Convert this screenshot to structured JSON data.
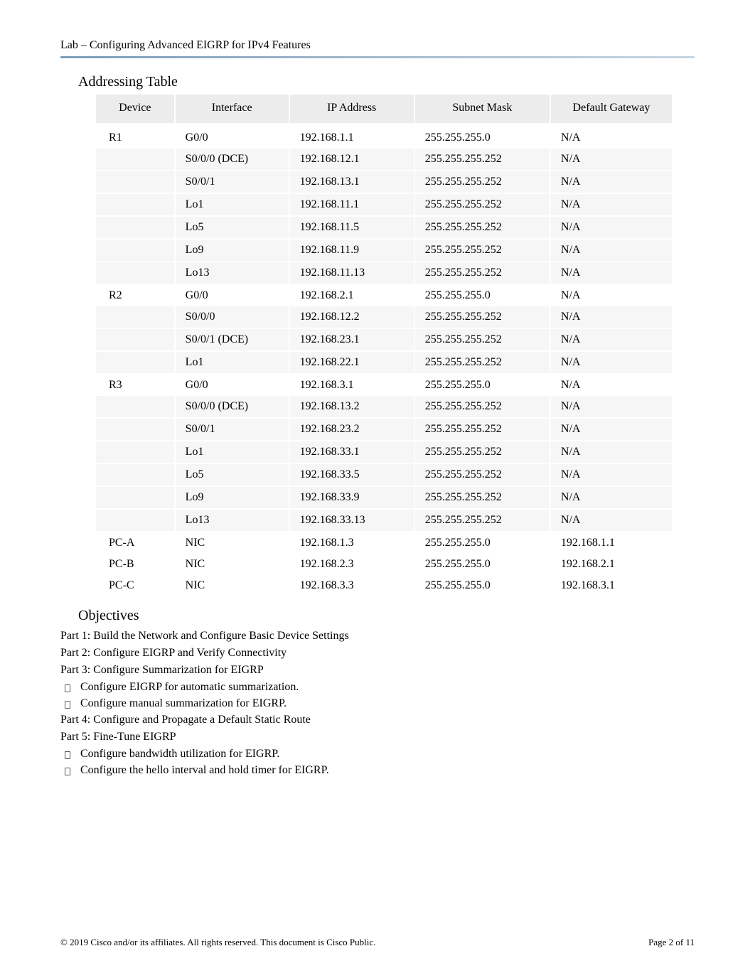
{
  "header": {
    "title": "Lab – Configuring Advanced EIGRP for IPv4 Features"
  },
  "sections": {
    "addressing_heading": "Addressing Table",
    "objectives_heading": "Objectives"
  },
  "table": {
    "headers": {
      "device": "Device",
      "interface": "Interface",
      "ip": "IP Address",
      "mask": "Subnet Mask",
      "gateway": "Default Gateway"
    },
    "rows": [
      {
        "device": "R1",
        "interface": "G0/0",
        "ip": "192.168.1.1",
        "mask": "255.255.255.0",
        "gateway": "N/A",
        "zebra": false
      },
      {
        "device": "",
        "interface": "S0/0/0 (DCE)",
        "ip": "192.168.12.1",
        "mask": "255.255.255.252",
        "gateway": "N/A",
        "zebra": true
      },
      {
        "device": "",
        "interface": "S0/0/1",
        "ip": "192.168.13.1",
        "mask": "255.255.255.252",
        "gateway": "N/A",
        "zebra": true
      },
      {
        "device": "",
        "interface": "Lo1",
        "ip": "192.168.11.1",
        "mask": "255.255.255.252",
        "gateway": "N/A",
        "zebra": true
      },
      {
        "device": "",
        "interface": "Lo5",
        "ip": "192.168.11.5",
        "mask": "255.255.255.252",
        "gateway": "N/A",
        "zebra": true
      },
      {
        "device": "",
        "interface": "Lo9",
        "ip": "192.168.11.9",
        "mask": "255.255.255.252",
        "gateway": "N/A",
        "zebra": true
      },
      {
        "device": "",
        "interface": "Lo13",
        "ip": "192.168.11.13",
        "mask": "255.255.255.252",
        "gateway": "N/A",
        "zebra": true
      },
      {
        "device": "R2",
        "interface": "G0/0",
        "ip": "192.168.2.1",
        "mask": "255.255.255.0",
        "gateway": "N/A",
        "zebra": false
      },
      {
        "device": "",
        "interface": "S0/0/0",
        "ip": "192.168.12.2",
        "mask": "255.255.255.252",
        "gateway": "N/A",
        "zebra": true
      },
      {
        "device": "",
        "interface": "S0/0/1 (DCE)",
        "ip": "192.168.23.1",
        "mask": "255.255.255.252",
        "gateway": "N/A",
        "zebra": true
      },
      {
        "device": "",
        "interface": "Lo1",
        "ip": "192.168.22.1",
        "mask": "255.255.255.252",
        "gateway": "N/A",
        "zebra": true
      },
      {
        "device": "R3",
        "interface": "G0/0",
        "ip": "192.168.3.1",
        "mask": "255.255.255.0",
        "gateway": "N/A",
        "zebra": false
      },
      {
        "device": "",
        "interface": "S0/0/0 (DCE)",
        "ip": "192.168.13.2",
        "mask": "255.255.255.252",
        "gateway": "N/A",
        "zebra": true
      },
      {
        "device": "",
        "interface": "S0/0/1",
        "ip": "192.168.23.2",
        "mask": "255.255.255.252",
        "gateway": "N/A",
        "zebra": true
      },
      {
        "device": "",
        "interface": "Lo1",
        "ip": "192.168.33.1",
        "mask": "255.255.255.252",
        "gateway": "N/A",
        "zebra": true
      },
      {
        "device": "",
        "interface": "Lo5",
        "ip": "192.168.33.5",
        "mask": "255.255.255.252",
        "gateway": "N/A",
        "zebra": true
      },
      {
        "device": "",
        "interface": "Lo9",
        "ip": "192.168.33.9",
        "mask": "255.255.255.252",
        "gateway": "N/A",
        "zebra": true
      },
      {
        "device": "",
        "interface": "Lo13",
        "ip": "192.168.33.13",
        "mask": "255.255.255.252",
        "gateway": "N/A",
        "zebra": true
      },
      {
        "device": "PC-A",
        "interface": "NIC",
        "ip": "192.168.1.3",
        "mask": "255.255.255.0",
        "gateway": "192.168.1.1",
        "zebra": false
      },
      {
        "device": "PC-B",
        "interface": "NIC",
        "ip": "192.168.2.3",
        "mask": "255.255.255.0",
        "gateway": "192.168.2.1",
        "zebra": false
      },
      {
        "device": "PC-C",
        "interface": "NIC",
        "ip": "192.168.3.3",
        "mask": "255.255.255.0",
        "gateway": "192.168.3.1",
        "zebra": false
      }
    ]
  },
  "objectives": {
    "part1": "Part 1: Build the Network and Configure Basic Device Settings",
    "part2": "Part 2: Configure EIGRP and Verify Connectivity",
    "part3": "Part 3: Configure Summarization for EIGRP",
    "part3_bullets": [
      "Configure EIGRP for automatic summarization.",
      "Configure manual summarization for EIGRP."
    ],
    "part4": "Part 4: Configure and Propagate a Default Static Route",
    "part5": "Part 5: Fine-Tune EIGRP",
    "part5_bullets": [
      "Configure bandwidth utilization for EIGRP.",
      "Configure the hello interval and hold timer for EIGRP."
    ]
  },
  "footer": {
    "left": "© 2019 Cisco and/or its affiliates. All rights reserved. This document is Cisco Public.",
    "right": "Page  2  of  11"
  }
}
